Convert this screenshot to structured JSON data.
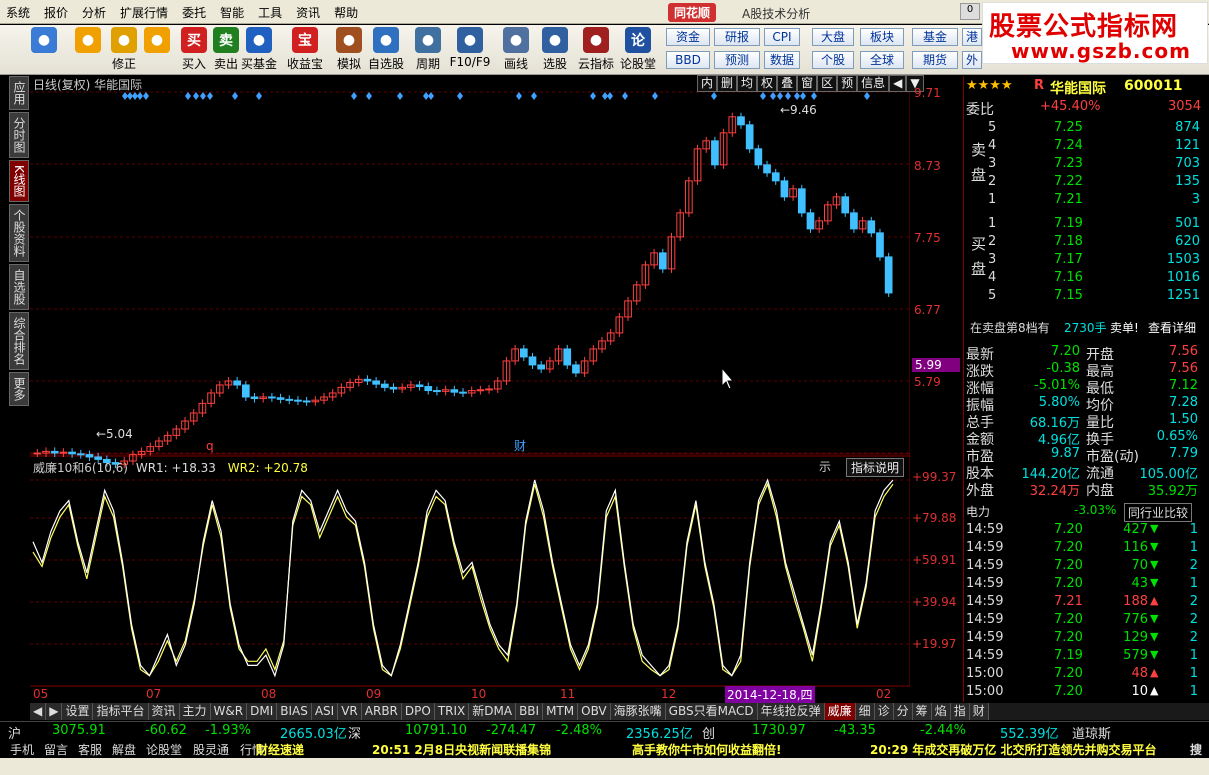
{
  "menu": [
    "系统",
    "报价",
    "分析",
    "扩展行情",
    "委托",
    "智能",
    "工具",
    "资讯",
    "帮助"
  ],
  "app": {
    "logo": "同花顺",
    "title": "A股技术分析",
    "minimize": "0"
  },
  "watermark": {
    "line1": "股票公式指标网",
    "line2": "www.gszb.com"
  },
  "toolbar": [
    {
      "label": "",
      "icon": "grid-icon",
      "color": "#3a7bd5"
    },
    {
      "label": "",
      "icon": "back-arrow-icon",
      "color": "#f0a000"
    },
    {
      "label": "修正",
      "icon": "updown-icon",
      "color": "#e0a000"
    },
    {
      "label": "",
      "icon": "smile-icon",
      "color": "#f0a000"
    },
    {
      "label": "买入",
      "icon": "买",
      "color": "#d02020"
    },
    {
      "label": "卖出",
      "icon": "卖",
      "color": "#208020"
    },
    {
      "label": "买基金",
      "icon": "fund-icon",
      "color": "#2060c0"
    },
    {
      "label": "收益宝",
      "icon": "宝",
      "color": "#d02020"
    },
    {
      "label": "模拟",
      "icon": "hammer-icon",
      "color": "#a05020"
    },
    {
      "label": "自选股",
      "icon": "star-icon",
      "color": "#3070c0"
    },
    {
      "label": "周期",
      "icon": "clock-icon",
      "color": "#4070a0"
    },
    {
      "label": "F10/F9",
      "icon": "doc-icon",
      "color": "#3060a0"
    },
    {
      "label": "画线",
      "icon": "pen-icon",
      "color": "#5070a0"
    },
    {
      "label": "选股",
      "icon": "select-icon",
      "color": "#3060a0"
    },
    {
      "label": "云指标",
      "icon": "cloud-icon",
      "color": "#a02020"
    },
    {
      "label": "论股堂",
      "icon": "论",
      "color": "#2050a0"
    }
  ],
  "toolbar_right": {
    "fund": "资金",
    "bbd": "BBD",
    "research": "研报",
    "forecast": "预测",
    "cpi": "CPI",
    "data": "数据",
    "market": "大盘",
    "single": "个股",
    "sector": "板块",
    "global": "全球",
    "funds": "基金",
    "futures": "期货",
    "hk": "港",
    "foreign": "外"
  },
  "sidebar": [
    {
      "label": "应用",
      "active": false
    },
    {
      "label": "分时图",
      "active": false
    },
    {
      "label": "K线图",
      "active": true
    },
    {
      "label": "个股资料",
      "active": false
    },
    {
      "label": "自选股",
      "active": false
    },
    {
      "label": "综合排名",
      "active": false
    },
    {
      "label": "更多",
      "active": false
    }
  ],
  "chart": {
    "caption": "日线(复权)  华能国际",
    "buttons": [
      "内",
      "删",
      "均",
      "权",
      "叠",
      "窗",
      "区",
      "预",
      "信息",
      "◀",
      "▼"
    ],
    "price_labels": [
      "9.71",
      "8.73",
      "7.75",
      "6.77",
      "5.79"
    ],
    "current_price": "5.99",
    "high_marker": "9.46",
    "low_marker": "5.04",
    "markers": [
      "q",
      "财"
    ],
    "date_labels": [
      "05",
      "07",
      "08",
      "09",
      "10",
      "11",
      "12",
      "02"
    ],
    "date_badge": "2014-12-18,四"
  },
  "indicator": {
    "name": "威廉10和6(10,6)",
    "wr1_label": "WR1: +18.33",
    "wr2_label": "WR2: +20.78",
    "help": "指标说明",
    "x": "示",
    "levels": [
      "+99.37",
      "+79.88",
      "+59.91",
      "+39.94",
      "+19.97"
    ]
  },
  "right_panel": {
    "stars": "★★★★",
    "r": "R",
    "name": "华能国际",
    "code": "600011",
    "weibi_label": "委比",
    "weibi": "+45.40%",
    "weicha": "3054",
    "sell_label": "卖盘",
    "buy_label": "买盘",
    "sell": [
      {
        "n": "5",
        "p": "7.25",
        "v": "874"
      },
      {
        "n": "4",
        "p": "7.24",
        "v": "121"
      },
      {
        "n": "3",
        "p": "7.23",
        "v": "703"
      },
      {
        "n": "2",
        "p": "7.22",
        "v": "135"
      },
      {
        "n": "1",
        "p": "7.21",
        "v": "3"
      }
    ],
    "buy": [
      {
        "n": "1",
        "p": "7.19",
        "v": "501"
      },
      {
        "n": "2",
        "p": "7.18",
        "v": "620"
      },
      {
        "n": "3",
        "p": "7.17",
        "v": "1503"
      },
      {
        "n": "4",
        "p": "7.16",
        "v": "1016"
      },
      {
        "n": "5",
        "p": "7.15",
        "v": "1251"
      }
    ],
    "notice": "在卖盘第8档有",
    "notice_vol": "2730手",
    "notice_act": "卖单!",
    "notice_more": "查看详细",
    "stats": [
      [
        "最新",
        "7.20",
        "开盘",
        "7.56"
      ],
      [
        "涨跌",
        "-0.38",
        "最高",
        "7.56"
      ],
      [
        "涨幅",
        "-5.01%",
        "最低",
        "7.12"
      ],
      [
        "振幅",
        "5.80%",
        "均价",
        "7.28"
      ],
      [
        "总手",
        "68.16万",
        "量比",
        "1.50"
      ],
      [
        "金额",
        "4.96亿",
        "换手",
        "0.65%"
      ],
      [
        "市盈",
        "9.87",
        "市盈(动)",
        "7.79"
      ],
      [
        "股本",
        "144.20亿",
        "流通",
        "105.00亿"
      ],
      [
        "外盘",
        "32.24万",
        "内盘",
        "35.92万"
      ]
    ],
    "industry": "电力",
    "industry_chg": "-3.03%",
    "industry_btn": "同行业比较",
    "ticks": [
      {
        "t": "14:59",
        "p": "7.20",
        "v": "427",
        "d": "down",
        "n": "1"
      },
      {
        "t": "14:59",
        "p": "7.20",
        "v": "116",
        "d": "down",
        "n": "1"
      },
      {
        "t": "14:59",
        "p": "7.20",
        "v": "70",
        "d": "down",
        "n": "2"
      },
      {
        "t": "14:59",
        "p": "7.20",
        "v": "43",
        "d": "down",
        "n": "1"
      },
      {
        "t": "14:59",
        "p": "7.21",
        "v": "188",
        "d": "up",
        "n": "2"
      },
      {
        "t": "14:59",
        "p": "7.20",
        "v": "776",
        "d": "down",
        "n": "2"
      },
      {
        "t": "14:59",
        "p": "7.20",
        "v": "129",
        "d": "down",
        "n": "2"
      },
      {
        "t": "14:59",
        "p": "7.19",
        "v": "579",
        "d": "down",
        "n": "1"
      },
      {
        "t": "15:00",
        "p": "7.20",
        "v": "48",
        "d": "up",
        "n": "1"
      },
      {
        "t": "15:00",
        "p": "7.20",
        "v": "10",
        "d": "flat",
        "n": "1"
      }
    ]
  },
  "bottom_tabs": [
    "设置",
    "指标平台",
    "资讯",
    "主力",
    "W&R",
    "DMI",
    "BIAS",
    "ASI",
    "VR",
    "ARBR",
    "DPO",
    "TRIX",
    "新DMA",
    "BBI",
    "MTM",
    "OBV",
    "海豚张嘴",
    "GBS只看MACD",
    "年线抢反弹",
    "威廉",
    "细",
    "诊",
    "分",
    "筹",
    "焰",
    "指",
    "财"
  ],
  "active_tab": "威廉",
  "status": {
    "sh_label": "沪",
    "sh_index": "3075.91",
    "sh_chg": "-60.62",
    "sh_pct": "-1.93%",
    "sh_amt": "2665.03亿",
    "sz_label": "深",
    "sz_index": "10791.10",
    "sz_chg": "-274.47",
    "sz_pct": "-2.48%",
    "sz_amt": "2356.25亿",
    "cy_label": "创",
    "cy_index": "1730.97",
    "cy_chg": "-43.35",
    "cy_pct": "-2.44%",
    "cy_amt": "552.39亿",
    "dj": "道琼斯"
  },
  "status2": [
    "手机",
    "留言",
    "客服",
    "解盘",
    "论股堂",
    "股灵通",
    "行情"
  ],
  "news": [
    "财经速递",
    "20:51 2月8日央视新闻联播集锦",
    "高手教你牛市如何收益翻倍!",
    "20:29 年成交再破万亿 北交所打造领先并购交易平台",
    "搜"
  ],
  "chart_data": {
    "type": "candlestick",
    "title": "日线(复权) 华能国际",
    "price_ticks": [
      9.71,
      8.73,
      7.75,
      6.77,
      5.79
    ],
    "close": [
      5.2,
      5.22,
      5.2,
      5.21,
      5.19,
      5.18,
      5.15,
      5.12,
      5.08,
      5.06,
      5.1,
      5.18,
      5.22,
      5.28,
      5.35,
      5.42,
      5.5,
      5.6,
      5.7,
      5.82,
      5.95,
      6.05,
      6.1,
      6.05,
      5.9,
      5.88,
      5.9,
      5.89,
      5.87,
      5.86,
      5.85,
      5.84,
      5.86,
      5.9,
      5.95,
      6.02,
      6.08,
      6.12,
      6.1,
      6.06,
      6.02,
      6.0,
      6.02,
      6.05,
      6.03,
      5.98,
      5.97,
      5.99,
      5.96,
      5.95,
      5.98,
      5.99,
      6.0,
      6.1,
      6.35,
      6.5,
      6.4,
      6.3,
      6.25,
      6.35,
      6.5,
      6.3,
      6.2,
      6.35,
      6.5,
      6.6,
      6.7,
      6.9,
      7.1,
      7.3,
      7.55,
      7.7,
      7.5,
      7.9,
      8.2,
      8.6,
      9.0,
      9.1,
      8.8,
      9.2,
      9.4,
      9.3,
      9.0,
      8.8,
      8.7,
      8.6,
      8.4,
      8.5,
      8.2,
      8.0,
      8.1,
      8.3,
      8.4,
      8.2,
      8.0,
      8.1,
      7.95,
      7.65,
      7.2
    ],
    "wr1": [
      70,
      60,
      75,
      85,
      90,
      70,
      55,
      75,
      95,
      85,
      60,
      30,
      10,
      5,
      15,
      25,
      10,
      20,
      40,
      70,
      90,
      75,
      40,
      20,
      10,
      10,
      15,
      5,
      20,
      80,
      95,
      90,
      75,
      85,
      95,
      85,
      80,
      60,
      30,
      10,
      5,
      20,
      40,
      60,
      85,
      95,
      90,
      70,
      55,
      60,
      45,
      30,
      20,
      15,
      40,
      80,
      100,
      85,
      60,
      40,
      20,
      10,
      20,
      40,
      85,
      95,
      60,
      30,
      15,
      10,
      5,
      10,
      30,
      70,
      90,
      60,
      40,
      10,
      5,
      15,
      60,
      90,
      100,
      85,
      60,
      45,
      30,
      15,
      40,
      70,
      80,
      60,
      30,
      50,
      85,
      95,
      100
    ],
    "wr2": [
      65,
      58,
      72,
      82,
      88,
      68,
      52,
      72,
      92,
      82,
      58,
      28,
      8,
      5,
      12,
      22,
      12,
      22,
      42,
      68,
      88,
      72,
      38,
      18,
      12,
      12,
      18,
      8,
      22,
      78,
      92,
      88,
      72,
      82,
      92,
      82,
      78,
      58,
      28,
      8,
      5,
      18,
      38,
      58,
      82,
      92,
      88,
      68,
      52,
      58,
      42,
      28,
      18,
      12,
      38,
      78,
      98,
      82,
      58,
      38,
      18,
      8,
      18,
      38,
      82,
      92,
      58,
      28,
      12,
      8,
      5,
      8,
      28,
      68,
      88,
      58,
      38,
      8,
      5,
      12,
      58,
      88,
      98,
      82,
      58,
      42,
      28,
      12,
      38,
      68,
      78,
      58,
      28,
      48,
      82,
      92,
      98
    ]
  }
}
